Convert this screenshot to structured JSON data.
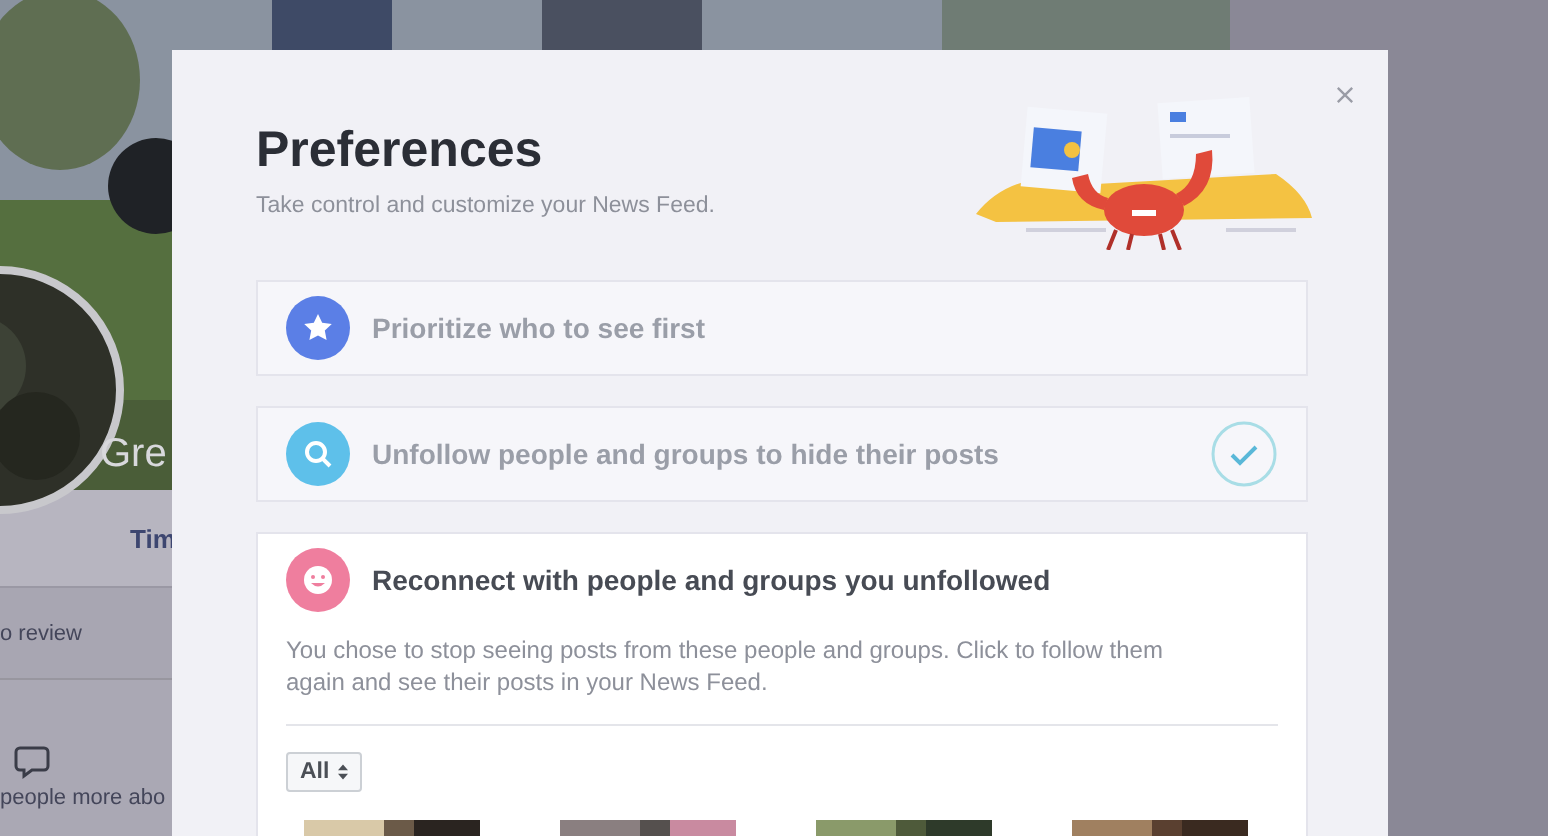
{
  "background": {
    "profile_name": "Gre",
    "tabs": [
      "Tim"
    ],
    "review_text": "o review",
    "footer_text": "people more abo"
  },
  "modal": {
    "title": "Preferences",
    "subtitle": "Take control and customize your News Feed.",
    "options": [
      {
        "kind": "star",
        "label": "Prioritize who to see first",
        "expanded": false,
        "done": false
      },
      {
        "kind": "search",
        "label": "Unfollow people and groups to hide their posts",
        "expanded": false,
        "done": true
      },
      {
        "kind": "smile",
        "label": "Reconnect with people and groups you unfollowed",
        "expanded": true,
        "done": false
      }
    ],
    "description": "You chose to stop seeing posts from these people and groups. Click to follow them again and see their posts in your News Feed.",
    "filter": "All"
  }
}
